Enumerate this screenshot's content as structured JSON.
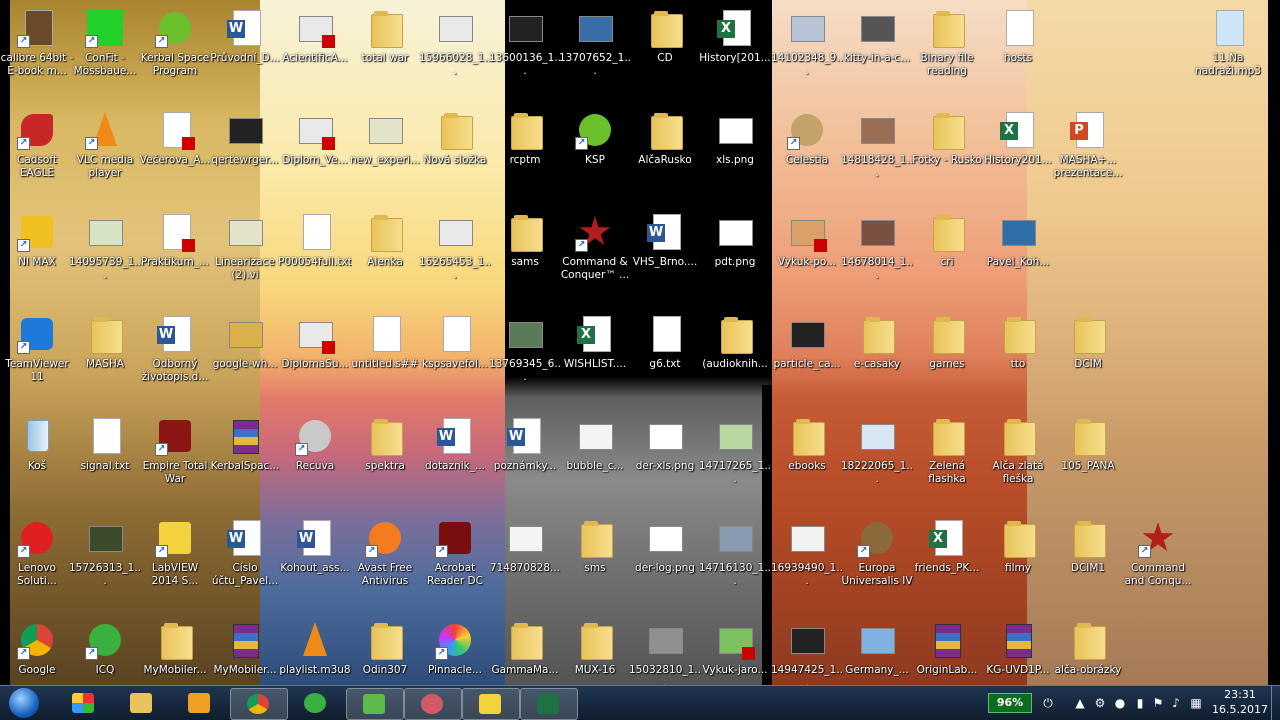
{
  "desktop": {
    "icons": [
      {
        "label": "calibre 64bit - E-book m..."
      },
      {
        "label": "ConFit - Mössbaue..."
      },
      {
        "label": "Kerbal Space Program"
      },
      {
        "label": "Průvodní_D..."
      },
      {
        "label": "AcientificA..."
      },
      {
        "label": "total war"
      },
      {
        "label": "15966028_1..."
      },
      {
        "label": "13600136_1..."
      },
      {
        "label": "13707652_1..."
      },
      {
        "label": "CD"
      },
      {
        "label": "History[201..."
      },
      {
        "label": "14102348_9..."
      },
      {
        "label": "kitty-in-a-c..."
      },
      {
        "label": "Binary file reading"
      },
      {
        "label": "hosts"
      },
      {
        "label": "11.Na nadraži.mp3"
      },
      {
        "label": "Cadsoft EAGLE"
      },
      {
        "label": "VLC media player"
      },
      {
        "label": "Večerova_A..."
      },
      {
        "label": "qertewrger..."
      },
      {
        "label": "Diplom_Ve..."
      },
      {
        "label": "new_experi..."
      },
      {
        "label": "Nová složka"
      },
      {
        "label": "rcptm"
      },
      {
        "label": "KSP"
      },
      {
        "label": "AlčaRusko"
      },
      {
        "label": "xls.png"
      },
      {
        "label": "Celestia"
      },
      {
        "label": "14818428_1..."
      },
      {
        "label": "Fotky - Rusko"
      },
      {
        "label": "History201..."
      },
      {
        "label": "MASHA+... prezentace..."
      },
      {
        "label": "NI MAX"
      },
      {
        "label": "14095739_1..."
      },
      {
        "label": "Praktikum_..."
      },
      {
        "label": "Linearizace (2).vi"
      },
      {
        "label": "P00054full.txt"
      },
      {
        "label": "Alenka"
      },
      {
        "label": "16265453_1..."
      },
      {
        "label": "sams"
      },
      {
        "label": "Command & Conquer™ ..."
      },
      {
        "label": "VHS_Brno...."
      },
      {
        "label": "pdt.png"
      },
      {
        "label": "Vykuk-po..."
      },
      {
        "label": "14678014_1..."
      },
      {
        "label": "cri"
      },
      {
        "label": "Pavel_Koh..."
      },
      {
        "label": "TeamViewer 11"
      },
      {
        "label": "MASHA"
      },
      {
        "label": "Odborný životopis.d..."
      },
      {
        "label": "google-wh..."
      },
      {
        "label": "DiplomaSu..."
      },
      {
        "label": "untitled.s##"
      },
      {
        "label": "kspsavefol..."
      },
      {
        "label": "13769345_6..."
      },
      {
        "label": "WISHLIST...."
      },
      {
        "label": "g6.txt"
      },
      {
        "label": "(audioknih..."
      },
      {
        "label": "particle_ca..."
      },
      {
        "label": "e-casaky"
      },
      {
        "label": "games"
      },
      {
        "label": "tto"
      },
      {
        "label": "DCIM"
      },
      {
        "label": "Koš"
      },
      {
        "label": "signal.txt"
      },
      {
        "label": "Empire Total War"
      },
      {
        "label": "KerbalSpac..."
      },
      {
        "label": "Recuva"
      },
      {
        "label": "spektra"
      },
      {
        "label": "dotaznik_..."
      },
      {
        "label": "poznámky..."
      },
      {
        "label": "bubble_c..."
      },
      {
        "label": "der-xls.png"
      },
      {
        "label": "14717265_1..."
      },
      {
        "label": "ebooks"
      },
      {
        "label": "18222065_1..."
      },
      {
        "label": "Zelená flashka"
      },
      {
        "label": "Alča zlatá fleška"
      },
      {
        "label": "105_PANA"
      },
      {
        "label": "Lenovo Soluti..."
      },
      {
        "label": "15726313_1..."
      },
      {
        "label": "LabVIEW 2014 S..."
      },
      {
        "label": "Číslo účtu_Pavel..."
      },
      {
        "label": "Kohout_ass..."
      },
      {
        "label": "Avast Free Antivirus"
      },
      {
        "label": "Acrobat Reader DC"
      },
      {
        "label": "714870828..."
      },
      {
        "label": "sms"
      },
      {
        "label": "der-log.png"
      },
      {
        "label": "14716130_1..."
      },
      {
        "label": "16939490_1..."
      },
      {
        "label": "Europa Universalis IV"
      },
      {
        "label": "friends_PK..."
      },
      {
        "label": "filmy"
      },
      {
        "label": "DCIM1"
      },
      {
        "label": "Command and Conqu..."
      },
      {
        "label": "Google"
      },
      {
        "label": "ICQ"
      },
      {
        "label": "MyMobiler..."
      },
      {
        "label": "MyMobiler..."
      },
      {
        "label": "playlist.m3u8"
      },
      {
        "label": "Odin307"
      },
      {
        "label": "Pinnacle..."
      },
      {
        "label": "GammaMa..."
      },
      {
        "label": "MUX-16"
      },
      {
        "label": "15032810_1..."
      },
      {
        "label": "Vykuk-jaro..."
      },
      {
        "label": "14947425_1..."
      },
      {
        "label": "Germany_..."
      },
      {
        "label": "OriginLab..."
      },
      {
        "label": "KG-UVD1P..."
      },
      {
        "label": "alča-obrázky"
      }
    ]
  },
  "taskbar": {
    "battery": "96%",
    "time": "23:31",
    "date": "16.5.2017"
  }
}
